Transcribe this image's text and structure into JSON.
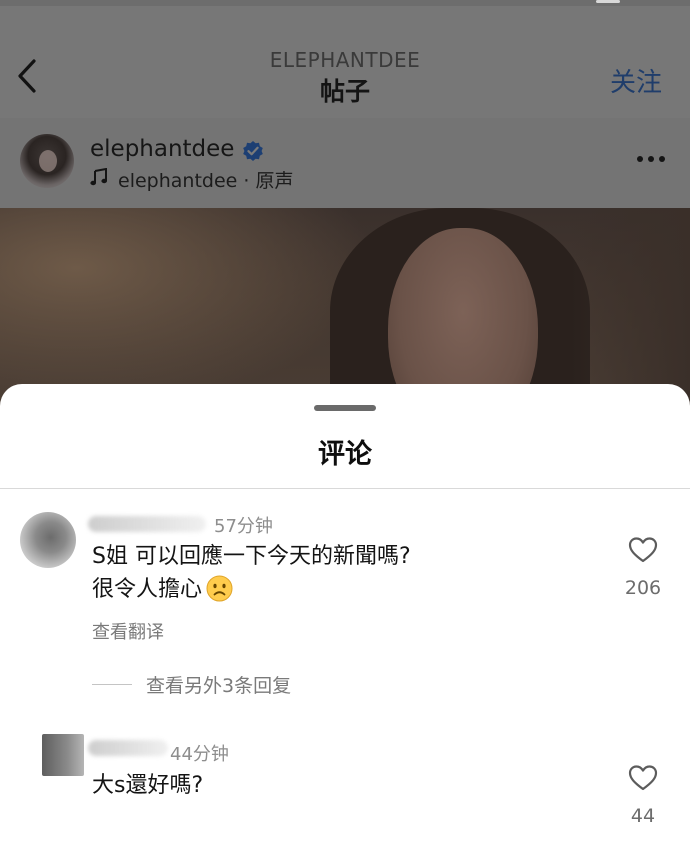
{
  "header": {
    "account": "ELEPHANTDEE",
    "title": "帖子",
    "follow_label": "关注",
    "back_icon": "chevron-left-icon"
  },
  "author": {
    "username": "elephantdee",
    "verified_icon": "verified-badge-icon",
    "audio_icon": "music-note-icon",
    "audio_text": "elephantdee · 原声",
    "more_icon": "more-horizontal-icon"
  },
  "comments_sheet": {
    "title": "评论",
    "comments": [
      {
        "time": "57分钟",
        "text_line1": "S姐 可以回應一下今天的新聞嗎?",
        "text_line2": "很令人擔心",
        "emoji": "frowning-face-icon",
        "translate_label": "查看翻译",
        "replies_label": "查看另外3条回复",
        "like_icon": "heart-outline-icon",
        "likes": "206"
      },
      {
        "time": "44分钟",
        "text_line1": "大s還好嗎?",
        "like_icon": "heart-outline-icon",
        "likes": "44"
      }
    ]
  },
  "colors": {
    "overlay_background": "#777777",
    "follow_blue": "#1f3d6b",
    "sheet_background": "#ffffff",
    "muted_text": "#8e8e8e"
  }
}
